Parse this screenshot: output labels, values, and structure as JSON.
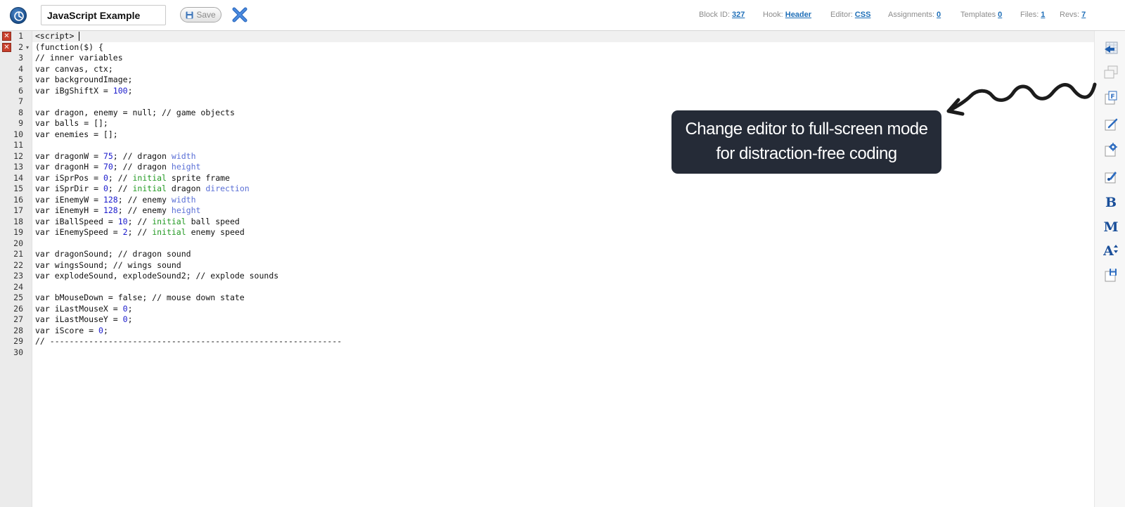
{
  "toolbar": {
    "title_value": "JavaScript Example",
    "save_label": "Save",
    "meta": [
      {
        "label": "Block ID:",
        "value": "327"
      },
      {
        "label": "Hook:",
        "value": "Header"
      },
      {
        "label": "Editor:",
        "value": "CSS"
      },
      {
        "label": "Assignments:",
        "value": "0"
      },
      {
        "label": "Templates",
        "value": "0"
      },
      {
        "label": "Files:",
        "value": "1"
      },
      {
        "label": "Revs:",
        "value": "7"
      }
    ]
  },
  "editor": {
    "line_numbers": [
      "1",
      "2",
      "3",
      "4",
      "5",
      "6",
      "7",
      "8",
      "9",
      "10",
      "11",
      "12",
      "13",
      "14",
      "15",
      "16",
      "17",
      "18",
      "19",
      "20",
      "21",
      "22",
      "23",
      "24",
      "25",
      "26",
      "27",
      "28",
      "29",
      "30"
    ],
    "lines": [
      "<script>",
      "(function($) {",
      "// inner variables",
      "var canvas, ctx;",
      "var backgroundImage;",
      "var iBgShiftX = 100;",
      "",
      "var dragon, enemy = null; // game objects",
      "var balls = [];",
      "var enemies = [];",
      "",
      "var dragonW = 75; // dragon width",
      "var dragonH = 70; // dragon height",
      "var iSprPos = 0; // initial sprite frame",
      "var iSprDir = 0; // initial dragon direction",
      "var iEnemyW = 128; // enemy width",
      "var iEnemyH = 128; // enemy height",
      "var iBallSpeed = 10; // initial ball speed",
      "var iEnemySpeed = 2; // initial enemy speed",
      "",
      "var dragonSound; // dragon sound",
      "var wingsSound; // wings sound",
      "var explodeSound, explodeSound2; // explode sounds",
      "",
      "var bMouseDown = false; // mouse down state",
      "var iLastMouseX = 0;",
      "var iLastMouseY = 0;",
      "var iScore = 0;",
      "// ------------------------------------------------------------",
      ""
    ],
    "error_lines": [
      "1",
      "2"
    ],
    "fold_marker_line": "2"
  },
  "tooltip": {
    "line1": "Change editor to full-screen mode",
    "line2": "for distraction-free coding"
  },
  "sidebar": {
    "buttons": [
      {
        "name": "fullscreen-icon",
        "glyph": ""
      },
      {
        "name": "windows-icon",
        "glyph": ""
      },
      {
        "name": "format-icon",
        "glyph": ""
      },
      {
        "name": "edit-icon",
        "glyph": ""
      },
      {
        "name": "settings-icon",
        "glyph": ""
      },
      {
        "name": "paint-icon",
        "glyph": ""
      },
      {
        "name": "bold-icon",
        "glyph": "B"
      },
      {
        "name": "monospace-icon",
        "glyph": "M"
      },
      {
        "name": "font-size-icon",
        "glyph": "A"
      },
      {
        "name": "save-disk-icon",
        "glyph": ""
      }
    ]
  },
  "colors": {
    "accent": "#1a4f9a",
    "tooltip_bg": "#252b37",
    "error": "#c9402c",
    "number": "#1a1acc",
    "keyword": "#229922",
    "property": "#5a6fd6"
  }
}
